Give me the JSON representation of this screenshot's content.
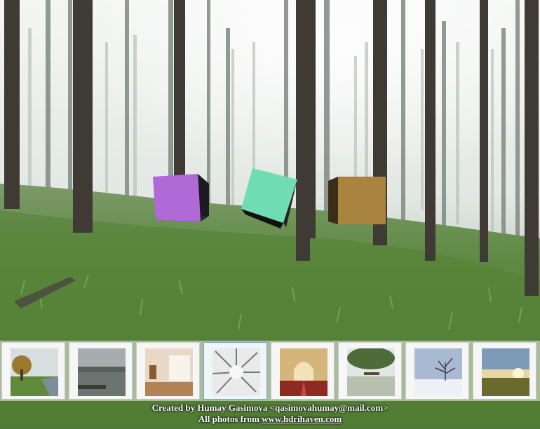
{
  "scene": {
    "cubes": [
      {
        "name": "purple-cube",
        "color": "#b06ad8"
      },
      {
        "name": "teal-cube",
        "color": "#6fdcb3"
      },
      {
        "name": "gold-cube",
        "color": "#a8843f"
      }
    ]
  },
  "thumbnails": [
    {
      "name": "autumn-park-lake",
      "selected": false
    },
    {
      "name": "misty-lake",
      "selected": false
    },
    {
      "name": "empty-room",
      "selected": false
    },
    {
      "name": "forest-canopy",
      "selected": true
    },
    {
      "name": "ornate-hall",
      "selected": false
    },
    {
      "name": "lakeside-tree",
      "selected": false
    },
    {
      "name": "snowy-tree",
      "selected": false
    },
    {
      "name": "sunset-field",
      "selected": false
    }
  ],
  "credits": {
    "line1": "Created by Humay Gasimova <qasimovahumay@mail.com>",
    "line2_prefix": "All photos from ",
    "line2_link": "www.hdrihaven.com"
  }
}
